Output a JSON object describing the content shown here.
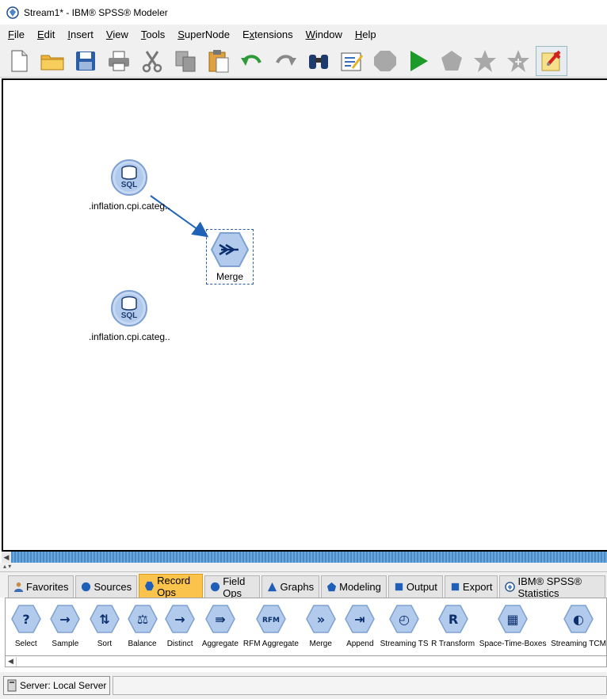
{
  "window": {
    "title": "Stream1* - IBM® SPSS® Modeler"
  },
  "menu": [
    {
      "label": "File",
      "key": "F",
      "rest": "ile"
    },
    {
      "label": "Edit",
      "key": "E",
      "rest": "dit"
    },
    {
      "label": "Insert",
      "key": "I",
      "rest": "nsert"
    },
    {
      "label": "View",
      "key": "V",
      "rest": "iew"
    },
    {
      "label": "Tools",
      "key": "T",
      "rest": "ools"
    },
    {
      "label": "SuperNode",
      "key": "S",
      "rest": "uperNode"
    },
    {
      "label": "Extensions",
      "key": "x",
      "pre": "E",
      "rest": "tensions"
    },
    {
      "label": "Window",
      "key": "W",
      "rest": "indow"
    },
    {
      "label": "Help",
      "key": "H",
      "rest": "elp"
    }
  ],
  "toolbar": [
    "new-document-icon",
    "open-folder-icon",
    "save-icon",
    "print-icon",
    "cut-icon",
    "copy-icon",
    "paste-icon",
    "undo-icon",
    "redo-icon",
    "find-binoculars-icon",
    "edit-annotation-icon",
    "stop-icon",
    "run-icon",
    "run-selection-icon",
    "star-icon",
    "star-plus-icon",
    "pin-annotation-icon"
  ],
  "canvas": {
    "nodes": {
      "sql1": {
        "label": ".inflation.cpi.categ..",
        "icon_text": "SQL"
      },
      "merge": {
        "label": "Merge"
      },
      "sql2": {
        "label": ".inflation.cpi.categ..",
        "icon_text": "SQL"
      }
    },
    "link_color": "#1f63b6"
  },
  "palette": {
    "tabs": [
      {
        "label": "Favorites",
        "icon": "person-icon",
        "active": false
      },
      {
        "label": "Sources",
        "icon": "circle-icon",
        "active": false
      },
      {
        "label": "Record Ops",
        "icon": "hexagon-icon",
        "active": true
      },
      {
        "label": "Field Ops",
        "icon": "circle-icon",
        "active": false
      },
      {
        "label": "Graphs",
        "icon": "triangle-icon",
        "active": false
      },
      {
        "label": "Modeling",
        "icon": "pentagon-icon",
        "active": false
      },
      {
        "label": "Output",
        "icon": "square-icon",
        "active": false
      },
      {
        "label": "Export",
        "icon": "square-icon",
        "active": false
      },
      {
        "label": "IBM® SPSS® Statistics",
        "icon": "spss-icon",
        "active": false
      }
    ],
    "nodes": [
      {
        "label": "Select",
        "glyph": "?"
      },
      {
        "label": "Sample",
        "glyph": "→"
      },
      {
        "label": "Sort",
        "glyph": "⇅"
      },
      {
        "label": "Balance",
        "glyph": "⚖"
      },
      {
        "label": "Distinct",
        "glyph": "→"
      },
      {
        "label": "Aggregate",
        "glyph": "⇛"
      },
      {
        "label": "RFM Aggregate",
        "glyph": "RFM"
      },
      {
        "label": "Merge",
        "glyph": "»"
      },
      {
        "label": "Append",
        "glyph": "⇥"
      },
      {
        "label": "Streaming TS",
        "glyph": "◴"
      },
      {
        "label": "R Transform",
        "glyph": "R"
      },
      {
        "label": "Space-Time-Boxes",
        "glyph": "▦"
      },
      {
        "label": "Streaming TCM",
        "glyph": "◐"
      }
    ],
    "accent": "#f9c34c"
  },
  "status": {
    "server": "Server: Local Server"
  }
}
